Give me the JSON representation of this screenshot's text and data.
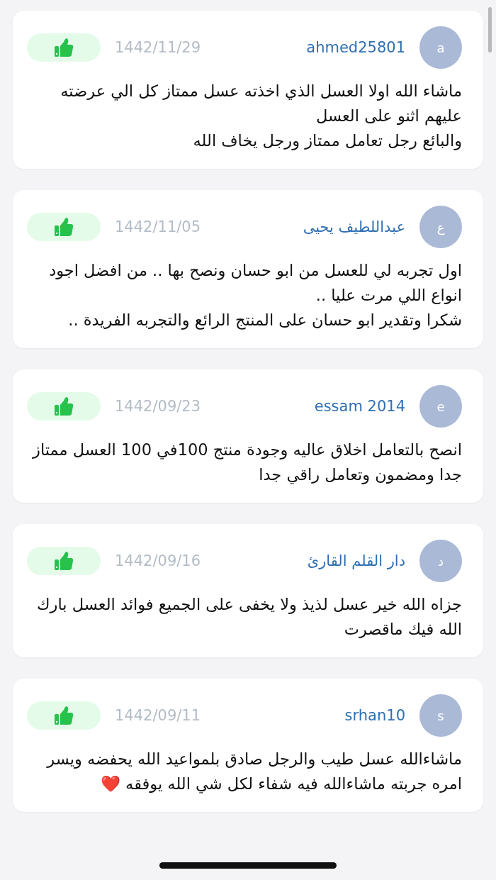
{
  "reviews": [
    {
      "avatar": "a",
      "user": "ahmed25801",
      "date": "1442/11/29",
      "text": "ماشاء الله اولا  العسل  الذي اخذته عسل ممتاز كل الي عرضته عليهم اثنو على العسل\nوالبائع رجل تعامل ممتاز ورجل يخاف الله"
    },
    {
      "avatar": "ع",
      "user": "عبداللطيف يحيى",
      "date": "1442/11/05",
      "text": "اول تجربه لي للعسل من ابو حسان ونصح بها .. من افضل اجود انواع اللي مرت عليا ..\nشكرا وتقدير ابو حسان على المنتج الرائع والتجربه الفريدة .."
    },
    {
      "avatar": "e",
      "user": "essam 2014",
      "date": "1442/09/23",
      "text": "انصح بالتعامل اخلاق عاليه وجودة منتج 100في 100 العسل ممتاز جدا ومضمون وتعامل راقي جدا"
    },
    {
      "avatar": "د",
      "user": "دار القلم القارئ",
      "date": "1442/09/16",
      "text": "جزاه الله خير عسل لذيذ ولا يخفى على الجميع فوائد العسل بارك الله فيك ماقصرت"
    },
    {
      "avatar": "s",
      "user": "srhan10",
      "date": "1442/09/11",
      "text": "ماشاءالله عسل طيب والرجل صادق بلمواعيد الله يحفضه ويسر امره جربته ماشاءالله فيه شفاء لكل شي الله يوفقه ❤️"
    }
  ]
}
